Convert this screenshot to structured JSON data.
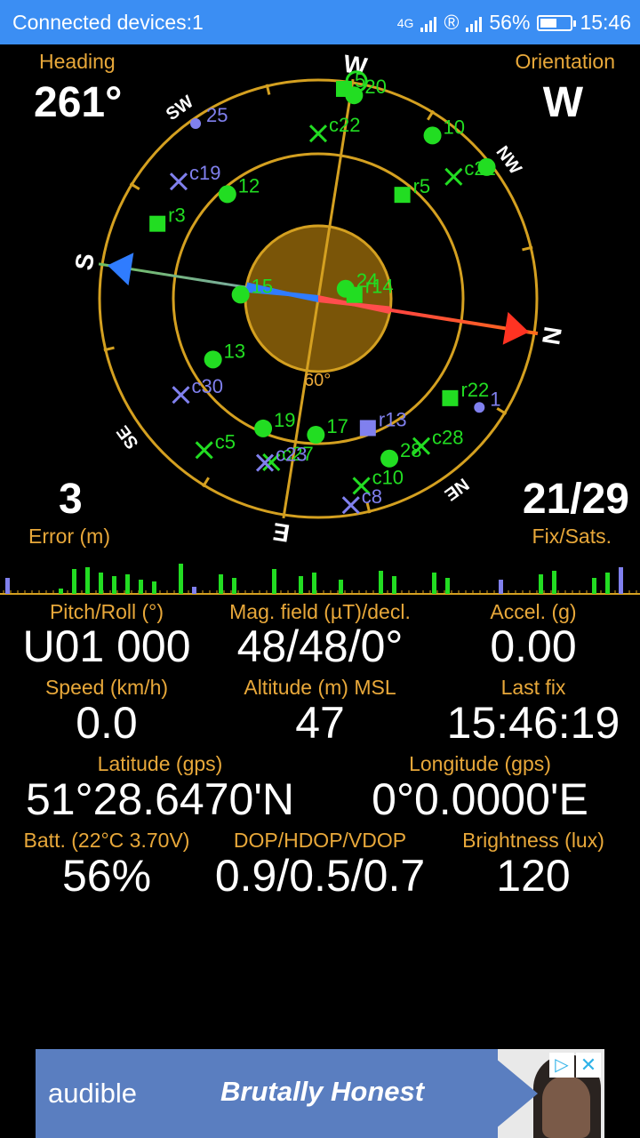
{
  "status_bar": {
    "title": "Connected devices:1",
    "network_label": "4G",
    "battery_percent": "56%",
    "battery_level": 0.56,
    "time": "15:46",
    "icons": [
      "network-4g-icon",
      "roaming-icon",
      "signal-icon",
      "battery-icon"
    ]
  },
  "top": {
    "heading_label": "Heading",
    "heading_value": "261°",
    "orientation_label": "Orientation",
    "orientation_value": "W",
    "error_value": "3",
    "error_label": "Error (m)",
    "fix_value": "21/29",
    "fix_label": "Fix/Sats."
  },
  "radar": {
    "heading_deg": 261,
    "inner_label": "60°",
    "ring_color": "#d4a020",
    "center_disc_color": "#7a5508",
    "needle_red": "#ff4d4d",
    "needle_blue": "#2f7cff",
    "cardinals": [
      {
        "label": "W",
        "bearing": 270
      },
      {
        "label": "NW",
        "bearing": 315
      },
      {
        "label": "N",
        "bearing": 0
      },
      {
        "label": "NE",
        "bearing": 45
      },
      {
        "label": "E",
        "bearing": 90
      },
      {
        "label": "SE",
        "bearing": 135
      },
      {
        "label": "S",
        "bearing": 180
      },
      {
        "label": "SW",
        "bearing": 225
      }
    ],
    "satellites": [
      {
        "id": "20",
        "shape": "circle",
        "color": "#22dd22",
        "az": 271,
        "el": 5
      },
      {
        "id": "5",
        "shape": "square",
        "color": "#22dd22",
        "az": 268,
        "el": 3
      },
      {
        "id": "10",
        "shape": "circle",
        "color": "#22dd22",
        "az": 296,
        "el": 8
      },
      {
        "id": "c22",
        "shape": "cross",
        "color": "#22dd22",
        "az": 261,
        "el": 22
      },
      {
        "id": "c21",
        "shape": "cross",
        "color": "#22dd22",
        "az": 309,
        "el": 15
      },
      {
        "id": "r5",
        "shape": "square",
        "color": "#22dd22",
        "az": 300,
        "el": 35
      },
      {
        "id": "c19",
        "shape": "cross",
        "color": "#8080ee",
        "az": 211,
        "el": 15
      },
      {
        "id": "12",
        "shape": "circle",
        "color": "#22dd22",
        "az": 220,
        "el": 33
      },
      {
        "id": "r3",
        "shape": "square",
        "color": "#22dd22",
        "az": 196,
        "el": 17
      },
      {
        "id": "24",
        "shape": "circle",
        "color": "#22dd22",
        "az": 331,
        "el": 78
      },
      {
        "id": "r14",
        "shape": "square",
        "color": "#22dd22",
        "az": 345,
        "el": 75
      },
      {
        "id": "15",
        "shape": "circle",
        "color": "#22dd22",
        "az": 174,
        "el": 58
      },
      {
        "id": "13",
        "shape": "circle",
        "color": "#22dd22",
        "az": 141,
        "el": 40
      },
      {
        "id": "c30",
        "shape": "cross",
        "color": "#8080ee",
        "az": 136,
        "el": 21
      },
      {
        "id": "19",
        "shape": "circle",
        "color": "#22dd22",
        "az": 104,
        "el": 32
      },
      {
        "id": "17",
        "shape": "circle",
        "color": "#22dd22",
        "az": 82,
        "el": 34
      },
      {
        "id": "r13",
        "shape": "square",
        "color": "#8080ee",
        "az": 60,
        "el": 33
      },
      {
        "id": "r22",
        "shape": "square",
        "color": "#22dd22",
        "az": 28,
        "el": 22
      },
      {
        "id": "1",
        "shape": "circle",
        "color": "#8080ee",
        "az": 25,
        "el": 10
      },
      {
        "id": "c28",
        "shape": "cross",
        "color": "#22dd22",
        "az": 46,
        "el": 16
      },
      {
        "id": "28",
        "shape": "circle",
        "color": "#22dd22",
        "az": 57,
        "el": 18
      },
      {
        "id": "c10",
        "shape": "cross",
        "color": "#22dd22",
        "az": 68,
        "el": 11
      },
      {
        "id": "c8",
        "shape": "cross",
        "color": "#8080ee",
        "az": 72,
        "el": 4
      },
      {
        "id": "c5",
        "shape": "cross",
        "color": "#22dd22",
        "az": 118,
        "el": 12
      },
      {
        "id": "c27",
        "shape": "cross",
        "color": "#22dd22",
        "az": 97,
        "el": 20
      },
      {
        "id": "c23",
        "shape": "cross",
        "color": "#8080ee",
        "az": 99,
        "el": 19
      },
      {
        "id": "NW",
        "shape": "circle",
        "color": "#22dd22",
        "az": 313,
        "el": 2
      },
      {
        "id": "25",
        "shape": "circle",
        "color": "#8080ee",
        "az": 226,
        "el": 2
      }
    ],
    "sun_marker": {
      "az": 271,
      "el": -2,
      "color": "#22dd22"
    }
  },
  "histogram": {
    "bars": [
      {
        "h": 18,
        "c": "#8080ee"
      },
      {
        "h": 0,
        "c": "#22dd22"
      },
      {
        "h": 0,
        "c": "#22dd22"
      },
      {
        "h": 0,
        "c": "#22dd22"
      },
      {
        "h": 6,
        "c": "#22dd22"
      },
      {
        "h": 28,
        "c": "#22dd22"
      },
      {
        "h": 30,
        "c": "#22dd22"
      },
      {
        "h": 24,
        "c": "#22dd22"
      },
      {
        "h": 20,
        "c": "#22dd22"
      },
      {
        "h": 22,
        "c": "#22dd22"
      },
      {
        "h": 16,
        "c": "#22dd22"
      },
      {
        "h": 14,
        "c": "#22dd22"
      },
      {
        "h": 0,
        "c": "#22dd22"
      },
      {
        "h": 34,
        "c": "#22dd22"
      },
      {
        "h": 8,
        "c": "#8080ee"
      },
      {
        "h": 0,
        "c": "#22dd22"
      },
      {
        "h": 22,
        "c": "#22dd22"
      },
      {
        "h": 18,
        "c": "#22dd22"
      },
      {
        "h": 0,
        "c": "#22dd22"
      },
      {
        "h": 0,
        "c": "#22dd22"
      },
      {
        "h": 28,
        "c": "#22dd22"
      },
      {
        "h": 0,
        "c": "#22dd22"
      },
      {
        "h": 20,
        "c": "#22dd22"
      },
      {
        "h": 24,
        "c": "#22dd22"
      },
      {
        "h": 0,
        "c": "#22dd22"
      },
      {
        "h": 16,
        "c": "#22dd22"
      },
      {
        "h": 0,
        "c": "#22dd22"
      },
      {
        "h": 0,
        "c": "#22dd22"
      },
      {
        "h": 26,
        "c": "#22dd22"
      },
      {
        "h": 20,
        "c": "#22dd22"
      },
      {
        "h": 0,
        "c": "#22dd22"
      },
      {
        "h": 0,
        "c": "#22dd22"
      },
      {
        "h": 24,
        "c": "#22dd22"
      },
      {
        "h": 18,
        "c": "#22dd22"
      },
      {
        "h": 0,
        "c": "#22dd22"
      },
      {
        "h": 0,
        "c": "#22dd22"
      },
      {
        "h": 0,
        "c": "#22dd22"
      },
      {
        "h": 16,
        "c": "#8080ee"
      },
      {
        "h": 0,
        "c": "#22dd22"
      },
      {
        "h": 0,
        "c": "#22dd22"
      },
      {
        "h": 22,
        "c": "#22dd22"
      },
      {
        "h": 26,
        "c": "#22dd22"
      },
      {
        "h": 0,
        "c": "#22dd22"
      },
      {
        "h": 0,
        "c": "#22dd22"
      },
      {
        "h": 18,
        "c": "#22dd22"
      },
      {
        "h": 24,
        "c": "#22dd22"
      },
      {
        "h": 30,
        "c": "#8080ee"
      },
      {
        "h": 0,
        "c": "#22dd22"
      }
    ],
    "tick_color": "#d4a020"
  },
  "sensors": [
    {
      "label": "Pitch/Roll (°)",
      "value": "U01 000"
    },
    {
      "label": "Mag. field (µT)/decl.",
      "value": "48/48/0°"
    },
    {
      "label": "Accel. (g)",
      "value": "0.00"
    },
    {
      "label": "Speed (km/h)",
      "value": "0.0"
    },
    {
      "label": "Altitude (m) MSL",
      "value": "47"
    },
    {
      "label": "Last fix",
      "value": "15:46:19"
    },
    {
      "label": "Latitude (gps)",
      "value": "51°28.6470'N"
    },
    {
      "label": "Longitude (gps)",
      "value": "0°0.0000'E"
    },
    {
      "label": "Batt. (22°C 3.70V)",
      "value": "56%"
    },
    {
      "label": "DOP/HDOP/VDOP",
      "value": "0.9/0.5/0.7"
    },
    {
      "label": "Brightness (lux)",
      "value": "120"
    }
  ],
  "ad": {
    "brand": "audible",
    "slogan": "Brutally Honest",
    "adchoices_icon": "adchoices-icon",
    "close_icon": "close-icon"
  }
}
